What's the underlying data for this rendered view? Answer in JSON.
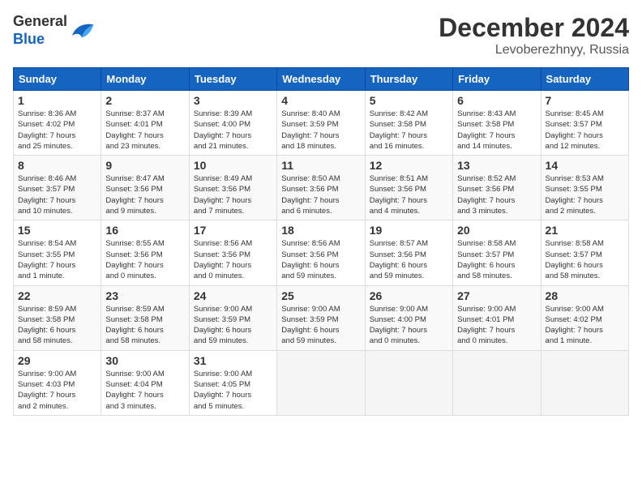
{
  "logo": {
    "general": "General",
    "blue": "Blue"
  },
  "header": {
    "month": "December 2024",
    "location": "Levoberezhnyy, Russia"
  },
  "weekdays": [
    "Sunday",
    "Monday",
    "Tuesday",
    "Wednesday",
    "Thursday",
    "Friday",
    "Saturday"
  ],
  "weeks": [
    [
      {
        "day": "1",
        "info": "Sunrise: 8:36 AM\nSunset: 4:02 PM\nDaylight: 7 hours\nand 25 minutes."
      },
      {
        "day": "2",
        "info": "Sunrise: 8:37 AM\nSunset: 4:01 PM\nDaylight: 7 hours\nand 23 minutes."
      },
      {
        "day": "3",
        "info": "Sunrise: 8:39 AM\nSunset: 4:00 PM\nDaylight: 7 hours\nand 21 minutes."
      },
      {
        "day": "4",
        "info": "Sunrise: 8:40 AM\nSunset: 3:59 PM\nDaylight: 7 hours\nand 18 minutes."
      },
      {
        "day": "5",
        "info": "Sunrise: 8:42 AM\nSunset: 3:58 PM\nDaylight: 7 hours\nand 16 minutes."
      },
      {
        "day": "6",
        "info": "Sunrise: 8:43 AM\nSunset: 3:58 PM\nDaylight: 7 hours\nand 14 minutes."
      },
      {
        "day": "7",
        "info": "Sunrise: 8:45 AM\nSunset: 3:57 PM\nDaylight: 7 hours\nand 12 minutes."
      }
    ],
    [
      {
        "day": "8",
        "info": "Sunrise: 8:46 AM\nSunset: 3:57 PM\nDaylight: 7 hours\nand 10 minutes."
      },
      {
        "day": "9",
        "info": "Sunrise: 8:47 AM\nSunset: 3:56 PM\nDaylight: 7 hours\nand 9 minutes."
      },
      {
        "day": "10",
        "info": "Sunrise: 8:49 AM\nSunset: 3:56 PM\nDaylight: 7 hours\nand 7 minutes."
      },
      {
        "day": "11",
        "info": "Sunrise: 8:50 AM\nSunset: 3:56 PM\nDaylight: 7 hours\nand 6 minutes."
      },
      {
        "day": "12",
        "info": "Sunrise: 8:51 AM\nSunset: 3:56 PM\nDaylight: 7 hours\nand 4 minutes."
      },
      {
        "day": "13",
        "info": "Sunrise: 8:52 AM\nSunset: 3:56 PM\nDaylight: 7 hours\nand 3 minutes."
      },
      {
        "day": "14",
        "info": "Sunrise: 8:53 AM\nSunset: 3:55 PM\nDaylight: 7 hours\nand 2 minutes."
      }
    ],
    [
      {
        "day": "15",
        "info": "Sunrise: 8:54 AM\nSunset: 3:55 PM\nDaylight: 7 hours\nand 1 minute."
      },
      {
        "day": "16",
        "info": "Sunrise: 8:55 AM\nSunset: 3:56 PM\nDaylight: 7 hours\nand 0 minutes."
      },
      {
        "day": "17",
        "info": "Sunrise: 8:56 AM\nSunset: 3:56 PM\nDaylight: 7 hours\nand 0 minutes."
      },
      {
        "day": "18",
        "info": "Sunrise: 8:56 AM\nSunset: 3:56 PM\nDaylight: 6 hours\nand 59 minutes."
      },
      {
        "day": "19",
        "info": "Sunrise: 8:57 AM\nSunset: 3:56 PM\nDaylight: 6 hours\nand 59 minutes."
      },
      {
        "day": "20",
        "info": "Sunrise: 8:58 AM\nSunset: 3:57 PM\nDaylight: 6 hours\nand 58 minutes."
      },
      {
        "day": "21",
        "info": "Sunrise: 8:58 AM\nSunset: 3:57 PM\nDaylight: 6 hours\nand 58 minutes."
      }
    ],
    [
      {
        "day": "22",
        "info": "Sunrise: 8:59 AM\nSunset: 3:58 PM\nDaylight: 6 hours\nand 58 minutes."
      },
      {
        "day": "23",
        "info": "Sunrise: 8:59 AM\nSunset: 3:58 PM\nDaylight: 6 hours\nand 58 minutes."
      },
      {
        "day": "24",
        "info": "Sunrise: 9:00 AM\nSunset: 3:59 PM\nDaylight: 6 hours\nand 59 minutes."
      },
      {
        "day": "25",
        "info": "Sunrise: 9:00 AM\nSunset: 3:59 PM\nDaylight: 6 hours\nand 59 minutes."
      },
      {
        "day": "26",
        "info": "Sunrise: 9:00 AM\nSunset: 4:00 PM\nDaylight: 7 hours\nand 0 minutes."
      },
      {
        "day": "27",
        "info": "Sunrise: 9:00 AM\nSunset: 4:01 PM\nDaylight: 7 hours\nand 0 minutes."
      },
      {
        "day": "28",
        "info": "Sunrise: 9:00 AM\nSunset: 4:02 PM\nDaylight: 7 hours\nand 1 minute."
      }
    ],
    [
      {
        "day": "29",
        "info": "Sunrise: 9:00 AM\nSunset: 4:03 PM\nDaylight: 7 hours\nand 2 minutes."
      },
      {
        "day": "30",
        "info": "Sunrise: 9:00 AM\nSunset: 4:04 PM\nDaylight: 7 hours\nand 3 minutes."
      },
      {
        "day": "31",
        "info": "Sunrise: 9:00 AM\nSunset: 4:05 PM\nDaylight: 7 hours\nand 5 minutes."
      },
      {
        "day": "",
        "info": ""
      },
      {
        "day": "",
        "info": ""
      },
      {
        "day": "",
        "info": ""
      },
      {
        "day": "",
        "info": ""
      }
    ]
  ]
}
